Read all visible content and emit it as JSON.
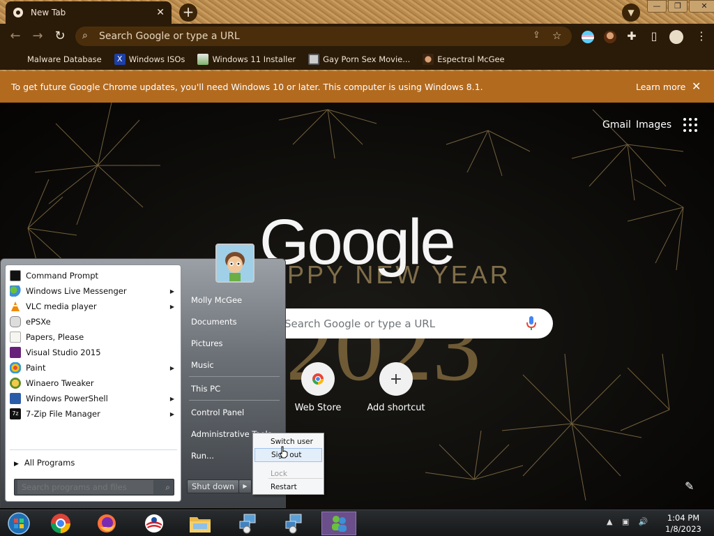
{
  "browser": {
    "tab_title": "New Tab",
    "tab_close": "✕",
    "new_tab": "+",
    "omnibox_placeholder": "Search Google or type a URL",
    "bookmarks": [
      {
        "label": "Malware Database",
        "icon": "skull-icon"
      },
      {
        "label": "Windows ISOs",
        "icon": "windows-x-icon"
      },
      {
        "label": "Windows 11 Installer",
        "icon": "image-icon"
      },
      {
        "label": "Gay Porn Sex Movie...",
        "icon": "bookmark-favicon-icon"
      },
      {
        "label": "Espectral McGee",
        "icon": "avatar-icon"
      }
    ],
    "infobar": {
      "message": "To get future Google Chrome updates, you'll need Windows 10 or later. This computer is using Windows 8.1.",
      "link": "Learn more"
    }
  },
  "ntp": {
    "gmail": "Gmail",
    "images": "Images",
    "logo": "Google",
    "doodle_line": "PPY NEW YEAR",
    "doodle_year": "2023",
    "search_placeholder": "Search Google or type a URL",
    "shortcuts": [
      {
        "label": "Web Store"
      },
      {
        "label": "Add shortcut",
        "glyph": "+"
      }
    ]
  },
  "start_menu": {
    "programs": [
      {
        "label": "Command Prompt",
        "icon": "cmd-icon",
        "submenu": false
      },
      {
        "label": "Windows Live Messenger",
        "icon": "messenger-icon",
        "submenu": true
      },
      {
        "label": "VLC media player",
        "icon": "vlc-icon",
        "submenu": true
      },
      {
        "label": "ePSXe",
        "icon": "gamepad-icon",
        "submenu": false
      },
      {
        "label": "Papers, Please",
        "icon": "document-icon",
        "submenu": false
      },
      {
        "label": "Visual Studio 2015",
        "icon": "visual-studio-icon",
        "submenu": false
      },
      {
        "label": "Paint",
        "icon": "paint-icon",
        "submenu": true
      },
      {
        "label": "Winaero Tweaker",
        "icon": "tweaker-icon",
        "submenu": false
      },
      {
        "label": "Windows PowerShell",
        "icon": "powershell-icon",
        "submenu": true
      },
      {
        "label": "7-Zip File Manager",
        "icon": "7zip-icon",
        "submenu": true
      }
    ],
    "all_programs": "All Programs",
    "search_placeholder": "Search programs and files",
    "right_links": [
      "Molly McGee",
      "Documents",
      "Pictures",
      "Music",
      "This PC",
      "Control Panel",
      "Administrative Tools",
      "Run..."
    ],
    "shutdown_label": "Shut down",
    "power_menu": [
      {
        "label": "Switch user",
        "state": "normal"
      },
      {
        "label": "Sign out",
        "state": "highlighted"
      },
      {
        "label": "Lock",
        "state": "disabled"
      },
      {
        "label": "Restart",
        "state": "normal"
      }
    ]
  },
  "taskbar": {
    "clock_time": "1:04 PM",
    "clock_date": "1/8/2023"
  },
  "colors": {
    "infobar": "#b26a1f",
    "chrome_dark": "#2a1a08",
    "taskbar_active": "#6a4f8a"
  }
}
